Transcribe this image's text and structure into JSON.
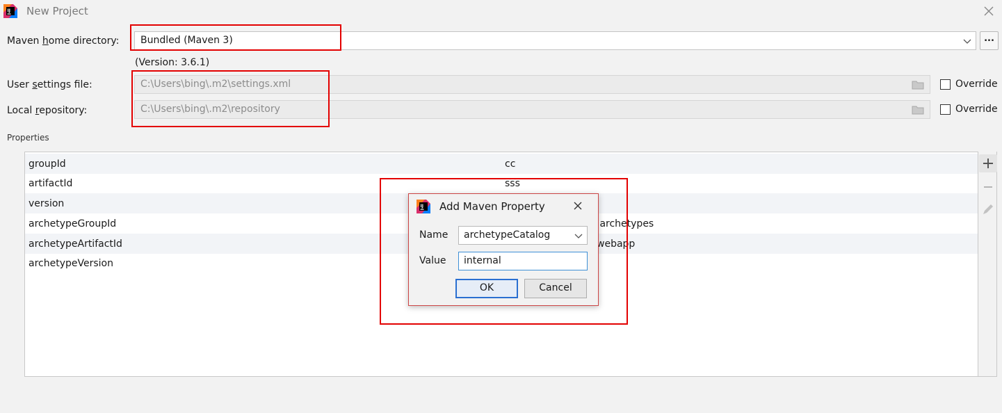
{
  "window": {
    "title": "New Project",
    "icon": "intellij-idea-icon",
    "close_icon": "close-icon"
  },
  "maven_home": {
    "label_prefix": "Maven ",
    "label_underlined": "h",
    "label_suffix": "ome directory:",
    "value": "Bundled (Maven 3)",
    "version": "(Version: 3.6.1)",
    "browse_label": "..."
  },
  "user_settings": {
    "label_prefix": "User ",
    "label_underlined": "s",
    "label_suffix": "ettings file:",
    "value": "C:\\Users\\bing\\.m2\\settings.xml",
    "override_label": "Override"
  },
  "local_repo": {
    "label_prefix": "Local ",
    "label_underlined": "r",
    "label_suffix": "epository:",
    "value": "C:\\Users\\bing\\.m2\\repository",
    "override_label": "Override"
  },
  "properties": {
    "label": "Properties",
    "rows": [
      {
        "key": "groupId",
        "value": "cc"
      },
      {
        "key": "artifactId",
        "value": "sss"
      },
      {
        "key": "version",
        "value": ""
      },
      {
        "key": "archetypeGroupId",
        "value": ".archetypes"
      },
      {
        "key": "archetypeArtifactId",
        "value": "webapp"
      },
      {
        "key": "archetypeVersion",
        "value": ""
      }
    ],
    "tools": {
      "add": "+",
      "remove": "−"
    }
  },
  "dialog": {
    "title": "Add Maven Property",
    "name_label": "Name",
    "name_value": "archetypeCatalog",
    "value_label": "Value",
    "value_value": "internal",
    "ok_label": "OK",
    "cancel_label": "Cancel"
  },
  "colors": {
    "annotation": "#e30000",
    "focus": "#3d8fd6"
  }
}
